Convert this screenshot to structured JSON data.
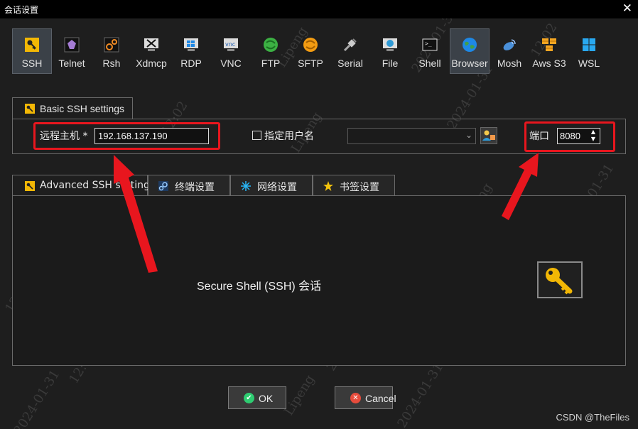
{
  "window": {
    "title": "会话设置"
  },
  "toolbar": {
    "items": [
      {
        "label": "SSH",
        "icon": "key-icon",
        "active": true
      },
      {
        "label": "Telnet",
        "icon": "telnet-icon"
      },
      {
        "label": "Rsh",
        "icon": "rsh-icon"
      },
      {
        "label": "Xdmcp",
        "icon": "xdmcp-icon"
      },
      {
        "label": "RDP",
        "icon": "rdp-icon"
      },
      {
        "label": "VNC",
        "icon": "vnc-icon"
      },
      {
        "label": "FTP",
        "icon": "ftp-icon"
      },
      {
        "label": "SFTP",
        "icon": "sftp-icon"
      },
      {
        "label": "Serial",
        "icon": "serial-icon"
      },
      {
        "label": "File",
        "icon": "file-icon"
      },
      {
        "label": "Shell",
        "icon": "shell-icon"
      },
      {
        "label": "Browser",
        "icon": "globe-icon",
        "active": true
      },
      {
        "label": "Mosh",
        "icon": "mosh-icon"
      },
      {
        "label": "Aws S3",
        "icon": "aws-icon"
      },
      {
        "label": "WSL",
        "icon": "windows-icon"
      }
    ]
  },
  "basic": {
    "tab_label": "Basic SSH settings",
    "host_label": "远程主机 *",
    "host_value": "192.168.137.190",
    "user_label": "指定用户名",
    "user_value": "",
    "port_label": "端口",
    "port_value": "8080"
  },
  "lower_tabs": [
    {
      "label": "Advanced SSH settings"
    },
    {
      "label": "终端设置"
    },
    {
      "label": "网络设置"
    },
    {
      "label": "书签设置"
    }
  ],
  "description": "Secure Shell (SSH) 会话",
  "buttons": {
    "ok": "OK",
    "cancel": "Cancel"
  },
  "watermark": {
    "credit": "CSDN @TheFiles",
    "tiles": [
      "Lipeng",
      "2024-01-31",
      "12:02"
    ]
  },
  "colors": {
    "annotation_red": "#e8161e",
    "accent_key": "#f2b705"
  }
}
